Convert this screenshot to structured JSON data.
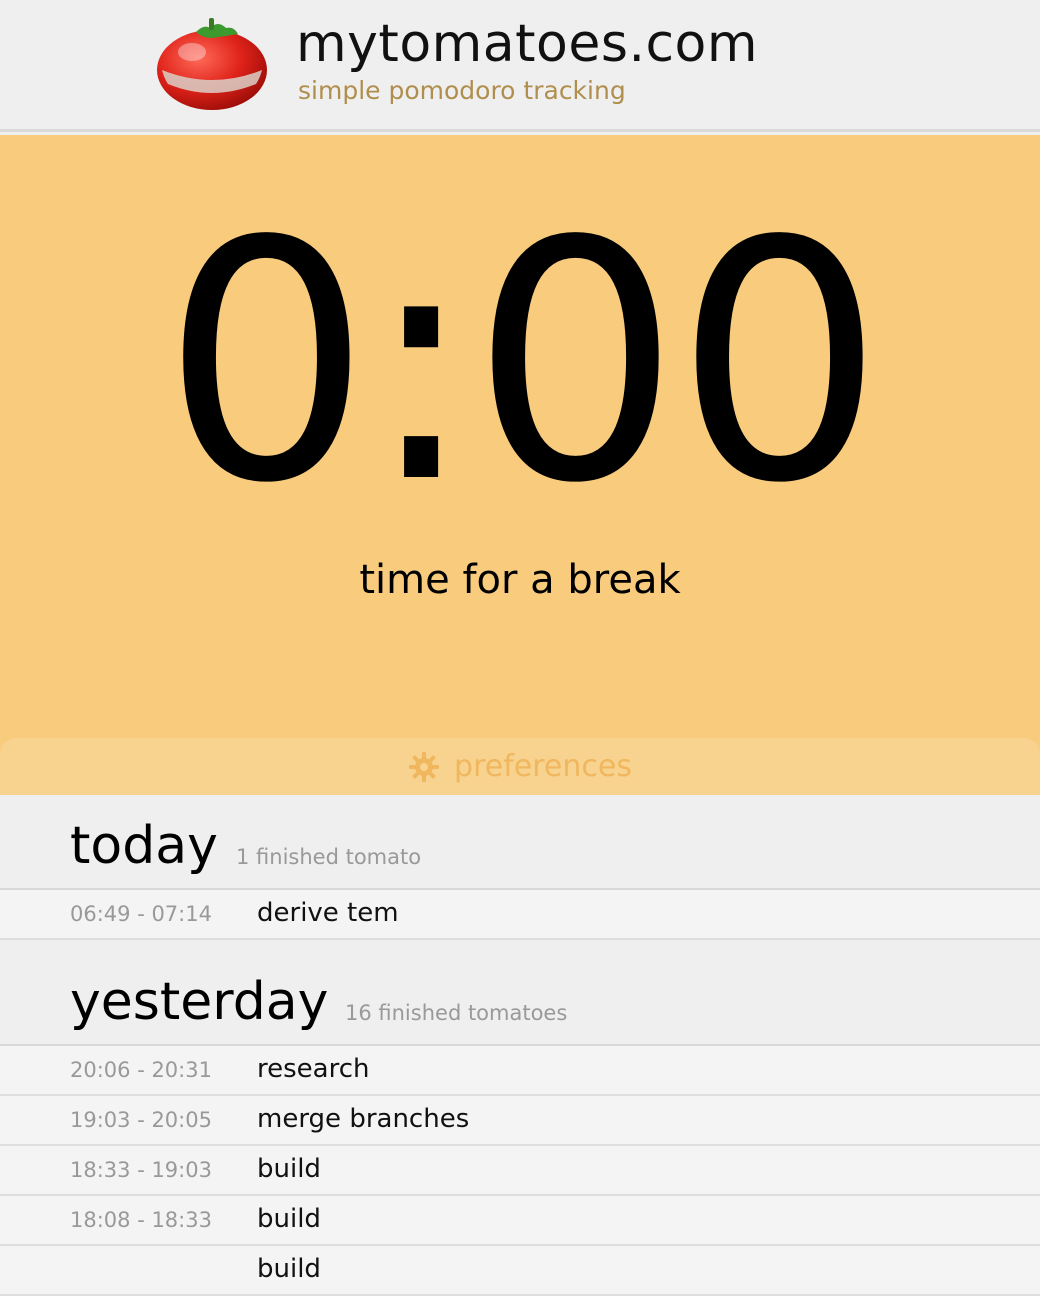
{
  "header": {
    "title": "mytomatoes.com",
    "subtitle": "simple pomodoro tracking",
    "logo_icon": "tomato-timer-icon"
  },
  "timer": {
    "display": "0:00",
    "status": "time for a break",
    "preferences_label": "preferences",
    "preferences_icon": "gear-icon"
  },
  "colors": {
    "timer_background": "#f8cb7d",
    "preferences_bar": "#f7d38f",
    "subtitle": "#b08f4e",
    "muted_text": "#999999"
  },
  "history": {
    "today": {
      "title": "today",
      "count": "1 finished tomato",
      "items": [
        {
          "time": "06:49 - 07:14",
          "task": "derive tem"
        }
      ]
    },
    "yesterday": {
      "title": "yesterday",
      "count": "16 finished tomatoes",
      "items": [
        {
          "time": "20:06 - 20:31",
          "task": "research"
        },
        {
          "time": "19:03 - 20:05",
          "task": "merge branches"
        },
        {
          "time": "18:33 - 19:03",
          "task": "build"
        },
        {
          "time": "18:08 - 18:33",
          "task": "build"
        },
        {
          "time": "",
          "task": "build"
        }
      ]
    }
  }
}
